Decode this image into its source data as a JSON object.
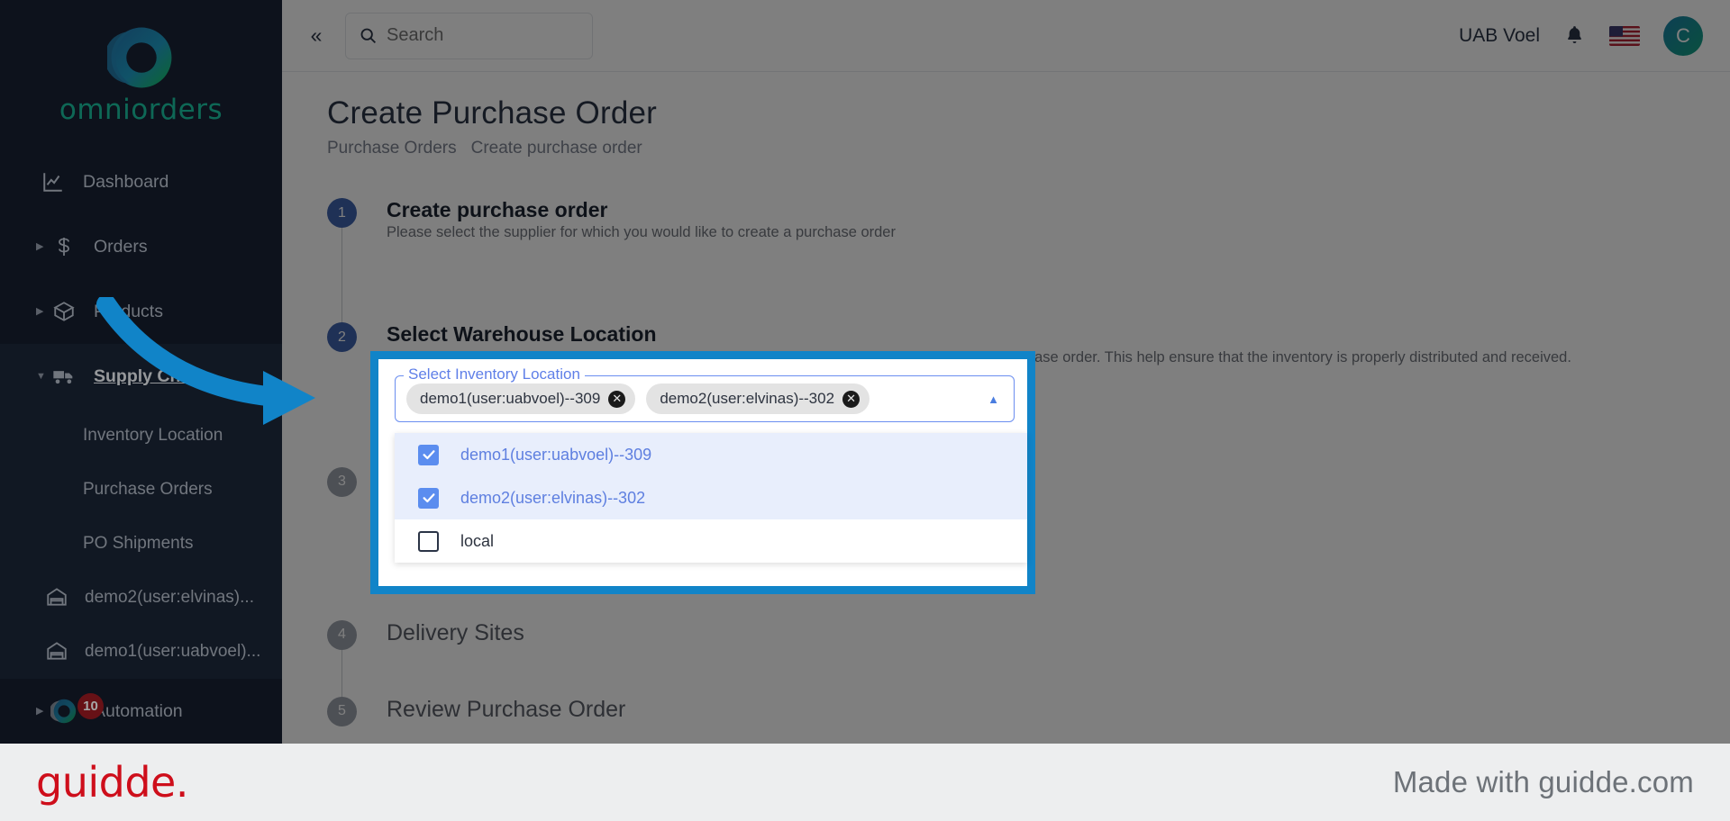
{
  "brand": {
    "name": "omniorders",
    "logo_icon": "omniorders-logo-icon"
  },
  "sidebar": {
    "items": [
      {
        "label": "Dashboard",
        "icon": "chart-line-icon",
        "caret": false
      },
      {
        "label": "Orders",
        "icon": "dollar-icon",
        "caret": true
      },
      {
        "label": "Products",
        "icon": "box-icon",
        "caret": true
      },
      {
        "label": "Supply Chain",
        "icon": "truck-icon",
        "caret": true,
        "expanded": true,
        "active": true
      }
    ],
    "supply_chain_children": [
      {
        "label": "Inventory Location"
      },
      {
        "label": "Purchase Orders"
      },
      {
        "label": "PO Shipments"
      }
    ],
    "warehouses": [
      {
        "label": "demo2(user:elvinas)...",
        "icon": "warehouse-icon"
      },
      {
        "label": "demo1(user:uabvoel)...",
        "icon": "warehouse-icon"
      }
    ],
    "automation": {
      "label": "Automation",
      "icon": "automation-logo-icon",
      "caret": true,
      "badge": "10"
    }
  },
  "topbar": {
    "collapse_icon": "chevron-double-left-icon",
    "search": {
      "placeholder": "Search",
      "value": "",
      "icon": "search-icon"
    },
    "org_name": "UAB Voel",
    "notifications_icon": "bell-icon",
    "language_icon": "us-flag-icon",
    "avatar_initial": "C"
  },
  "page": {
    "title": "Create Purchase Order",
    "breadcrumb": [
      "Purchase Orders",
      "Create purchase order"
    ]
  },
  "steps": [
    {
      "number": "1",
      "title": "Create purchase order",
      "desc": "Please select the supplier for which you would like to create a purchase order",
      "active": true
    },
    {
      "number": "2",
      "title": "Select Warehouse Location",
      "desc": "Please select the blocs to which would like to send the inventory that you are ordering in this purchase order. This help ensure that the inventory is properly distributed and received.",
      "active": true
    },
    {
      "number": "3",
      "title": "",
      "desc": "",
      "active": false
    },
    {
      "number": "4",
      "title": "Delivery Sites",
      "desc": "",
      "active": false
    },
    {
      "number": "5",
      "title": "Review Purchase Order",
      "desc": "",
      "active": false
    }
  ],
  "inventory_select": {
    "legend": "Select Inventory Location",
    "chips": [
      {
        "label": "demo1(user:uabvoel)--309",
        "remove_icon": "close-circle-icon"
      },
      {
        "label": "demo2(user:elvinas)--302",
        "remove_icon": "close-circle-icon"
      }
    ],
    "toggle_icon": "chevron-up-icon",
    "options": [
      {
        "label": "demo1(user:uabvoel)--309",
        "checked": true
      },
      {
        "label": "demo2(user:elvinas)--302",
        "checked": true
      },
      {
        "label": "local",
        "checked": false
      }
    ]
  },
  "annotation": {
    "arrow_icon": "curved-arrow-right-icon",
    "highlight_color": "#1184c8"
  },
  "footer": {
    "logo_text": "guidde.",
    "made_with": "Made with guidde.com"
  },
  "colors": {
    "sidebar_bg": "#141c2b",
    "brand_green": "#16a085",
    "accent_blue": "#1184c8",
    "step_active": "#3f62ad",
    "guidde_red": "#ce0e1b"
  }
}
